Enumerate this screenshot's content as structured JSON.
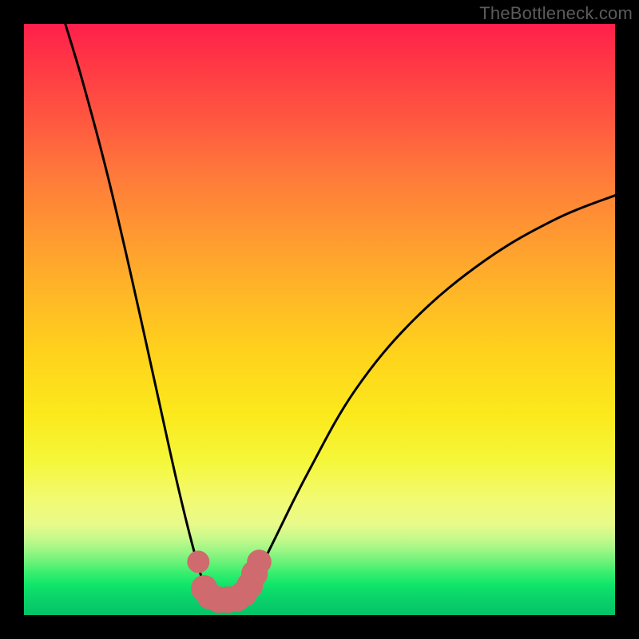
{
  "watermark": {
    "text": "TheBottleneck.com"
  },
  "colors": {
    "frame_bg": "#000000",
    "gradient_top": "#ff1f4c",
    "gradient_bottom": "#05c367",
    "curve_stroke": "#000000",
    "marker_fill": "#cf6a6e"
  },
  "chart_data": {
    "type": "line",
    "title": "",
    "xlabel": "",
    "ylabel": "",
    "x_range": [
      0,
      100
    ],
    "y_range": [
      0,
      100
    ],
    "note": "Axes are implied (no ticks shown). y≈0 is bottom (green / good), y≈100 is top (red / bottleneck).",
    "series": [
      {
        "name": "bottleneck-curve",
        "description": "Smooth V-shaped curve. Left arm falls steeply from upper-left to a flat minimum near x≈33, then right arm rises with decreasing slope toward upper-right.",
        "points": [
          {
            "x": 7,
            "y": 100
          },
          {
            "x": 10,
            "y": 90
          },
          {
            "x": 14,
            "y": 75
          },
          {
            "x": 18,
            "y": 58
          },
          {
            "x": 22,
            "y": 40
          },
          {
            "x": 26,
            "y": 22
          },
          {
            "x": 29,
            "y": 10
          },
          {
            "x": 31,
            "y": 4
          },
          {
            "x": 33,
            "y": 2.5
          },
          {
            "x": 36,
            "y": 2.5
          },
          {
            "x": 38,
            "y": 4
          },
          {
            "x": 42,
            "y": 12
          },
          {
            "x": 48,
            "y": 24
          },
          {
            "x": 56,
            "y": 38
          },
          {
            "x": 66,
            "y": 50
          },
          {
            "x": 78,
            "y": 60
          },
          {
            "x": 90,
            "y": 67
          },
          {
            "x": 100,
            "y": 71
          }
        ]
      }
    ],
    "markers": {
      "name": "highlight-dots",
      "color": "#cf6a6e",
      "description": "Cluster of rounded pink dots hugging the curve around its minimum.",
      "points": [
        {
          "x": 29.5,
          "y": 9,
          "r": 1.2
        },
        {
          "x": 30.5,
          "y": 4.5,
          "r": 1.6
        },
        {
          "x": 31.5,
          "y": 3.2,
          "r": 1.6
        },
        {
          "x": 33,
          "y": 2.6,
          "r": 1.6
        },
        {
          "x": 34.5,
          "y": 2.6,
          "r": 1.6
        },
        {
          "x": 36,
          "y": 2.8,
          "r": 1.6
        },
        {
          "x": 37.2,
          "y": 3.6,
          "r": 1.6
        },
        {
          "x": 38.2,
          "y": 5,
          "r": 1.6
        },
        {
          "x": 39,
          "y": 7,
          "r": 1.6
        },
        {
          "x": 39.8,
          "y": 9,
          "r": 1.4
        }
      ]
    }
  }
}
